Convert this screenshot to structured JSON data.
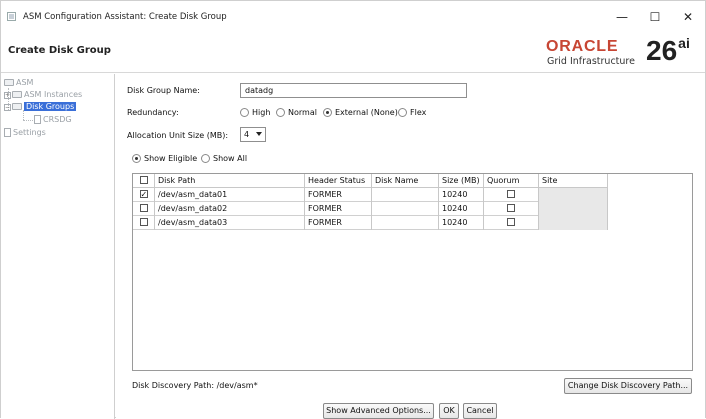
{
  "window": {
    "title": "ASM Configuration Assistant: Create Disk Group",
    "min_symbol": "—",
    "max_symbol": "☐",
    "close_symbol": "✕"
  },
  "header": {
    "page_title": "Create Disk Group",
    "brand": {
      "company": "ORACLE",
      "product": "Grid Infrastructure",
      "version": "26",
      "version_suffix": "ai",
      "brand_color": "#c74634"
    }
  },
  "tree": {
    "items": [
      {
        "label": "ASM"
      },
      {
        "label": "ASM Instances"
      },
      {
        "label": "Disk Groups",
        "selected": true
      },
      {
        "label": "CRSDG"
      },
      {
        "label": "Settings"
      }
    ]
  },
  "form": {
    "disk_group_name_label": "Disk Group Name:",
    "disk_group_name_value": "datadg",
    "redundancy_label": "Redundancy:",
    "redundancy_options": [
      {
        "label": "High",
        "selected": false
      },
      {
        "label": "Normal",
        "selected": false
      },
      {
        "label": "External (None)",
        "selected": true
      },
      {
        "label": "Flex",
        "selected": false
      }
    ],
    "au_size_label": "Allocation Unit Size (MB):",
    "au_size_value": "4",
    "filter_options": [
      {
        "label": "Show Eligible",
        "selected": true
      },
      {
        "label": "Show All",
        "selected": false
      }
    ]
  },
  "disk_table": {
    "columns": [
      "Disk Path",
      "Header Status",
      "Disk Name",
      "Size (MB)",
      "Quorum",
      "Site"
    ],
    "rows": [
      {
        "checked": true,
        "disk_path": "/dev/asm_data01",
        "header_status": "FORMER",
        "disk_name": "",
        "size_mb": "10240",
        "quorum": false,
        "site": ""
      },
      {
        "checked": false,
        "disk_path": "/dev/asm_data02",
        "header_status": "FORMER",
        "disk_name": "",
        "size_mb": "10240",
        "quorum": false,
        "site": ""
      },
      {
        "checked": false,
        "disk_path": "/dev/asm_data03",
        "header_status": "FORMER",
        "disk_name": "",
        "size_mb": "10240",
        "quorum": false,
        "site": ""
      }
    ]
  },
  "discovery": {
    "path_text": "Disk Discovery Path: /dev/asm*",
    "change_button": "Change Disk Discovery Path..."
  },
  "footer": {
    "advanced_button": "Show Advanced Options...",
    "ok_button": "OK",
    "cancel_button": "Cancel"
  }
}
